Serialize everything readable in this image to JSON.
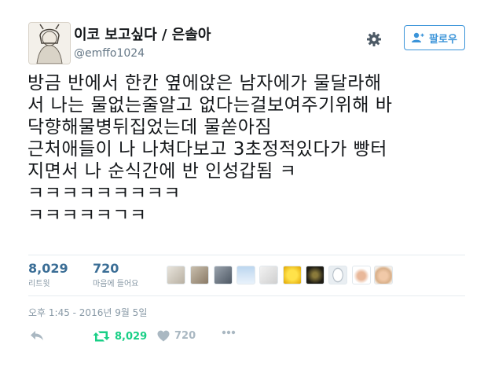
{
  "user": {
    "display_name": "이코 보고싶다 / 은솔아",
    "handle": "@emffo1024"
  },
  "follow_button": {
    "label": "팔로우"
  },
  "tweet": {
    "lines": [
      "방금 반에서 한칸 옆에앉은 남자에가 물달라해",
      "서 나는 물없는줄알고 없다는걸보여주기위해 바",
      "닥향해물병뒤집었는데 물쏟아짐",
      "근처애들이 나 나쳐다보고 3초정적있다가 빵터",
      "지면서 나 순식간에 반 인성갑됨 ㅋ",
      "ㅋㅋㅋㅋㅋㅋㅋㅋㅋ",
      "ㅋㅋㅋㅋㅋㄱㅋ"
    ]
  },
  "stats": {
    "retweets": {
      "count": "8,029",
      "label": "리트윗"
    },
    "likes": {
      "count": "720",
      "label": "마음에 들어요"
    }
  },
  "timestamp": "오후 1:45 - 2016년 9월 5일",
  "actions": {
    "retweet_count": "8,029",
    "like_count": "720"
  },
  "colors": {
    "accent": "#3b94d9",
    "retweet_green": "#19cf86",
    "muted": "#8899a6",
    "stat_number": "#3b6e96"
  }
}
